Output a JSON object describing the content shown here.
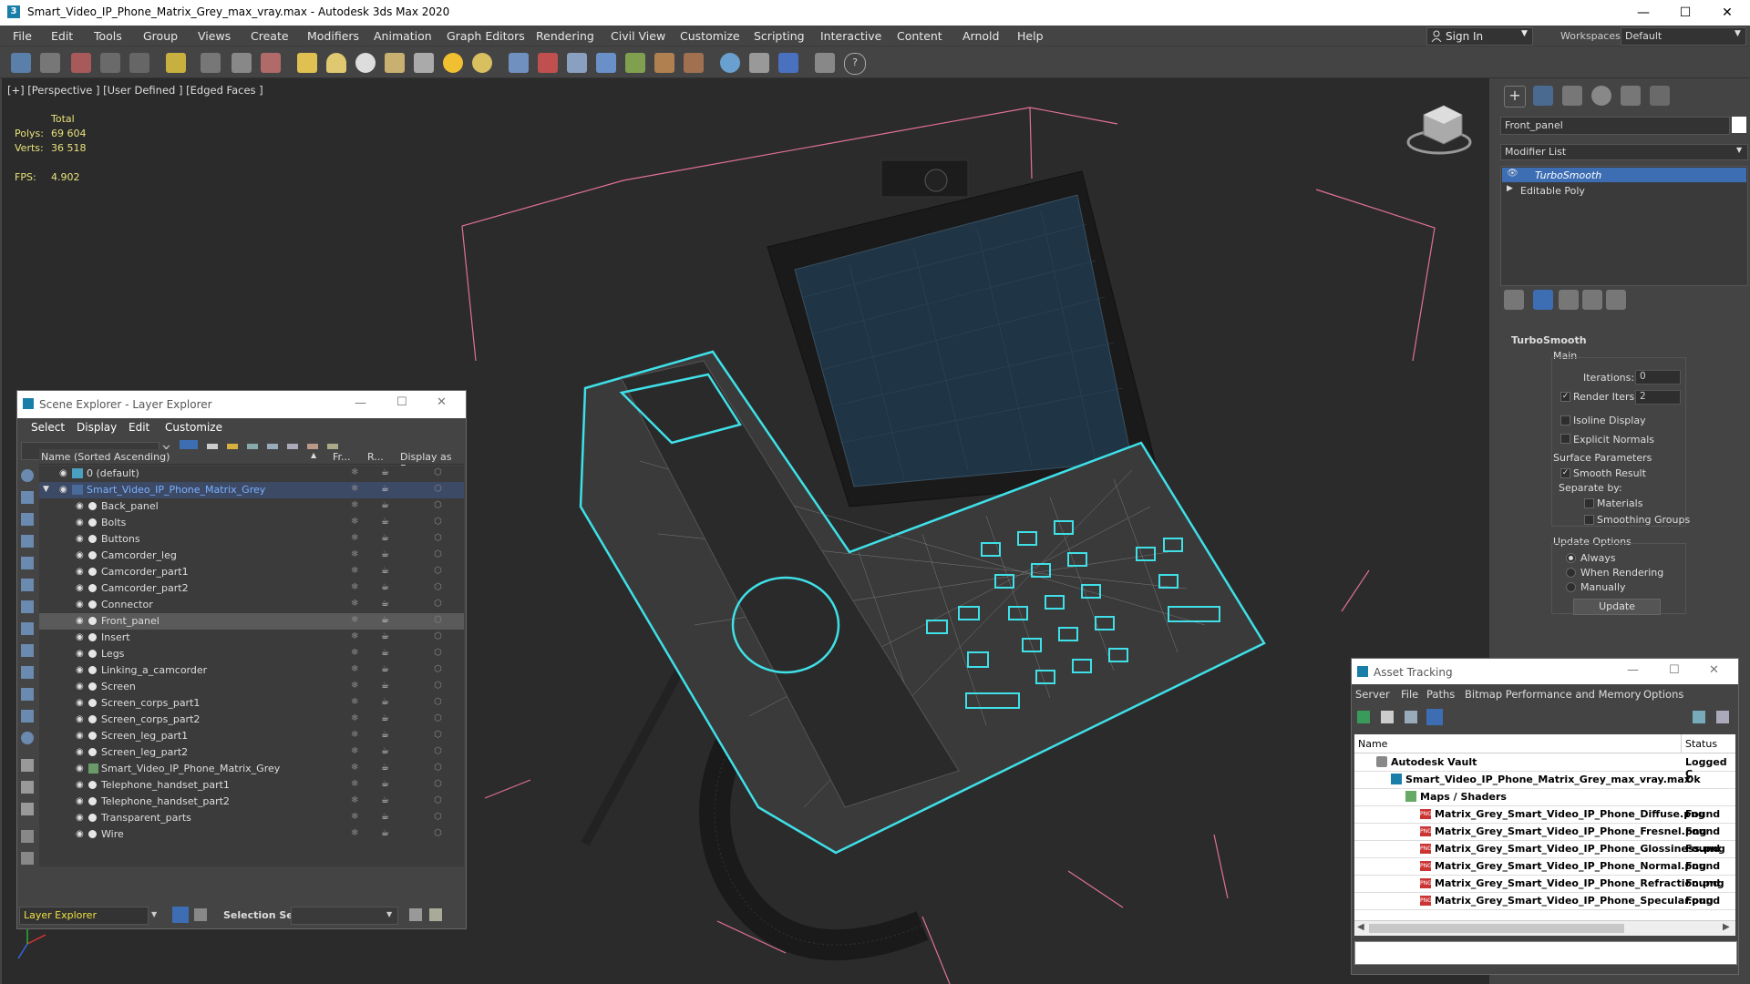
{
  "window": {
    "title": "Smart_Video_IP_Phone_Matrix_Grey_max_vray.max - Autodesk 3ds Max 2020",
    "minimize": "—",
    "maximize": "☐",
    "close": "✕"
  },
  "menubar": {
    "items": [
      "File",
      "Edit",
      "Tools",
      "Group",
      "Views",
      "Create",
      "Modifiers",
      "Animation",
      "Graph Editors",
      "Rendering",
      "Civil View",
      "Customize",
      "Scripting",
      "Interactive",
      "Content",
      "Arnold",
      "Help"
    ],
    "sign_in": "Sign In",
    "workspaces_label": "Workspaces:",
    "workspace_value": "Default"
  },
  "viewport": {
    "label": "[+] [Perspective ] [User Defined ] [Edged Faces ]",
    "stats": {
      "total_label": "Total",
      "polys_label": "Polys:",
      "polys_value": "69 604",
      "verts_label": "Verts:",
      "verts_value": "36 518",
      "fps_label": "FPS:",
      "fps_value": "4.902"
    }
  },
  "command_panel": {
    "object_name": "Front_panel",
    "modifier_list_label": "Modifier List",
    "stack": [
      "TurboSmooth",
      "Editable Poly"
    ],
    "rollout_title": "TurboSmooth",
    "main_label": "Main",
    "iterations_label": "Iterations:",
    "iterations_value": "0",
    "render_iters_label": "Render Iters:",
    "render_iters_value": "2",
    "isoline_label": "Isoline Display",
    "explicit_normals_label": "Explicit Normals",
    "surface_params_label": "Surface Parameters",
    "smooth_result_label": "Smooth Result",
    "separate_by_label": "Separate by:",
    "materials_label": "Materials",
    "smoothing_groups_label": "Smoothing Groups",
    "update_options_label": "Update Options",
    "always_label": "Always",
    "when_rendering_label": "When Rendering",
    "manually_label": "Manually",
    "update_button": "Update"
  },
  "scene_explorer": {
    "title": "Scene Explorer - Layer Explorer",
    "menu": [
      "Select",
      "Display",
      "Edit",
      "Customize"
    ],
    "columns": [
      "Name (Sorted Ascending)",
      "Fr...",
      "R...",
      "Display as Box"
    ],
    "layers": [
      {
        "name": "0 (default)",
        "level": 0
      },
      {
        "name": "Smart_Video_IP_Phone_Matrix_Grey",
        "level": 0
      }
    ],
    "objects": [
      "Back_panel",
      "Bolts",
      "Buttons",
      "Camcorder_leg",
      "Camcorder_part1",
      "Camcorder_part2",
      "Connector",
      "Front_panel",
      "Insert",
      "Legs",
      "Linking_a_camcorder",
      "Screen",
      "Screen_corps_part1",
      "Screen_corps_part2",
      "Screen_leg_part1",
      "Screen_leg_part2",
      "Smart_Video_IP_Phone_Matrix_Grey",
      "Telephone_handset_part1",
      "Telephone_handset_part2",
      "Transparent_parts",
      "Wire"
    ],
    "footer_dropdown": "Layer Explorer",
    "selection_set_label": "Selection Set:"
  },
  "asset_tracking": {
    "title": "Asset Tracking",
    "menu": [
      "Server",
      "File",
      "Paths",
      "Bitmap Performance and Memory",
      "Options"
    ],
    "columns": [
      "Name",
      "Status"
    ],
    "rows": [
      {
        "name": "Autodesk Vault",
        "status": "Logged C",
        "indent": 1
      },
      {
        "name": "Smart_Video_IP_Phone_Matrix_Grey_max_vray.max",
        "status": "Ok",
        "indent": 2
      },
      {
        "name": "Maps / Shaders",
        "status": "",
        "indent": 3
      },
      {
        "name": "Matrix_Grey_Smart_Video_IP_Phone_Diffuse.png",
        "status": "Found",
        "indent": 4
      },
      {
        "name": "Matrix_Grey_Smart_Video_IP_Phone_Fresnel.png",
        "status": "Found",
        "indent": 4
      },
      {
        "name": "Matrix_Grey_Smart_Video_IP_Phone_Glossiness.png",
        "status": "Found",
        "indent": 4
      },
      {
        "name": "Matrix_Grey_Smart_Video_IP_Phone_Normal.png",
        "status": "Found",
        "indent": 4
      },
      {
        "name": "Matrix_Grey_Smart_Video_IP_Phone_Refraction.png",
        "status": "Found",
        "indent": 4
      },
      {
        "name": "Matrix_Grey_Smart_Video_IP_Phone_Specular.png",
        "status": "Found",
        "indent": 4
      }
    ]
  },
  "colors": {
    "selection_cyan": "#3fe0e8",
    "bounding_pink": "#e0709a",
    "stats_yellow": "#e8e27a",
    "highlight_blue": "#3d6eb4"
  }
}
